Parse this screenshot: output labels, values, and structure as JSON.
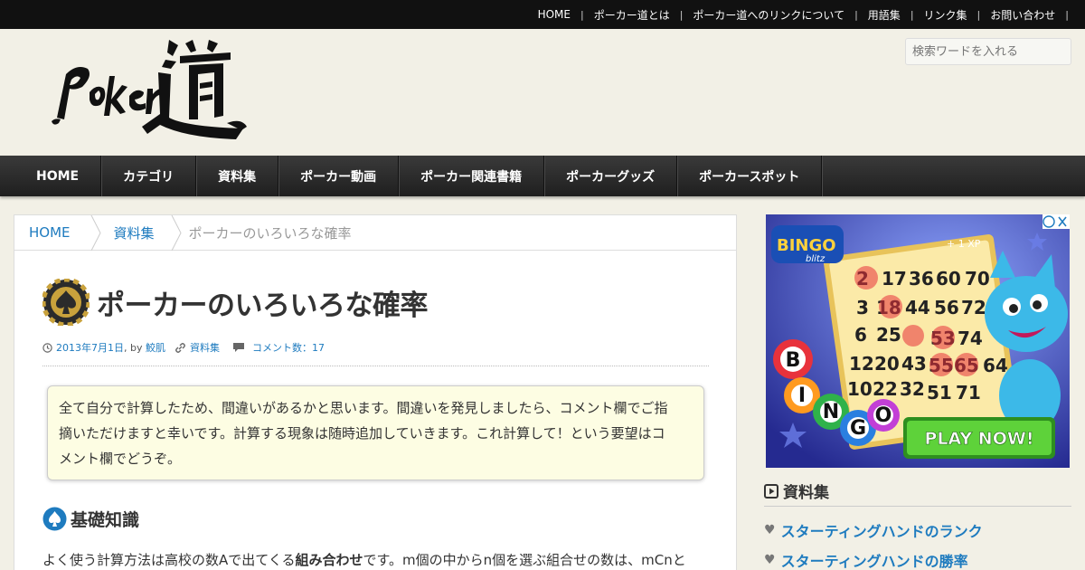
{
  "topnav": [
    {
      "label": "HOME"
    },
    {
      "label": "ポーカー道とは"
    },
    {
      "label": "ポーカー道へのリンクについて"
    },
    {
      "label": "用語集"
    },
    {
      "label": "リンク集"
    },
    {
      "label": "お問い合わせ"
    }
  ],
  "search": {
    "placeholder": "検索ワードを入れる"
  },
  "mainnav": [
    {
      "label": "HOME"
    },
    {
      "label": "カテゴリ"
    },
    {
      "label": "資料集"
    },
    {
      "label": "ポーカー動画"
    },
    {
      "label": "ポーカー関連書籍"
    },
    {
      "label": "ポーカーグッズ"
    },
    {
      "label": "ポーカースポット"
    }
  ],
  "breadcrumb": {
    "home": "HOME",
    "category": "資料集",
    "current": "ポーカーのいろいろな確率"
  },
  "article": {
    "title": "ポーカーのいろいろな確率",
    "date": "2013年7月1日",
    "by": ", by",
    "author": "鮫肌",
    "category": "資料集",
    "comments": "コメント数：17",
    "note_line1": "全て自分で計算したため、間違いがあるかと思います。間違いを発見しましたら、コメント欄でご指",
    "note_line2": "摘いただけますと幸いです。計算する現象は随時追加していきます。これ計算して！という要望はコ",
    "note_line3": "メント欄でどうぞ。",
    "section_heading": "基礎知識",
    "para_part1": "よく使う計算方法は高校の数Aで出てくる",
    "para_bold": "組み合わせ",
    "para_part2": "です。m個の中からn個を選ぶ組合せの数は、mCnと"
  },
  "sidebar": {
    "heading": "資料集",
    "items": [
      {
        "label": "スターティングハンドのランク"
      },
      {
        "label": "スターティングハンドの勝率"
      }
    ]
  },
  "ad": {
    "play_now": "PLAY NOW!",
    "bingo_letters": [
      "B",
      "I",
      "N",
      "G",
      "O"
    ],
    "bingo_logo": "BINGO",
    "bingo_logo_sub": "blitz",
    "xp": "+ 1 XP",
    "card_numbers": [
      "2",
      "17",
      "36",
      "60",
      "70",
      "3",
      "18",
      "44",
      "56",
      "72",
      "6",
      "25",
      "53",
      "74",
      "12",
      "20",
      "43",
      "55",
      "65",
      "64",
      "10",
      "22",
      "32",
      "51",
      "71"
    ]
  },
  "colors": {
    "link": "#1e7bbf",
    "topbar": "#111111",
    "nav": "#2b2b2b",
    "note_bg": "#fdfde3",
    "page_bg": "#f2f0e6"
  }
}
